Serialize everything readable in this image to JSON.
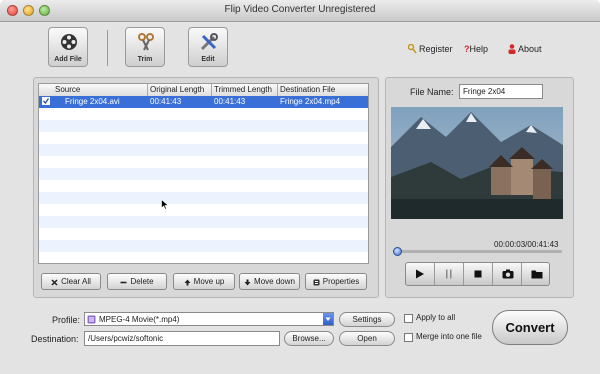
{
  "window": {
    "title": "Flip Video Converter Unregistered"
  },
  "toolbar": {
    "add_file": "Add File",
    "trim": "Trim",
    "edit": "Edit"
  },
  "links": {
    "register": "Register",
    "help": "Help",
    "about": "About"
  },
  "table": {
    "columns": [
      "Source",
      "Original Length",
      "Trimmed Length",
      "Destination File"
    ],
    "rows": [
      {
        "source": "Fringe 2x04.avi",
        "original": "00:41:43",
        "trimmed": "00:41:43",
        "destination": "Fringe 2x04.mp4",
        "checked": true,
        "selected": true
      }
    ]
  },
  "list_buttons": {
    "clear_all": "Clear All",
    "delete": "Delete",
    "move_up": "Move up",
    "move_down": "Move down",
    "properties": "Properties"
  },
  "preview": {
    "file_name_label": "File Name:",
    "file_name_value": "Fringe 2x04",
    "time": "00:00:03/00:41:43",
    "progress": 0.0012
  },
  "output": {
    "profile_label": "Profile:",
    "profile_value": "MPEG-4 Movie(*.mp4)",
    "settings": "Settings",
    "destination_label": "Destination:",
    "destination_value": "/Users/pcwiz/softonic",
    "browse": "Browse...",
    "open": "Open",
    "apply_to_all": "Apply to all",
    "merge": "Merge into one file",
    "convert": "Convert"
  },
  "colors": {
    "selection": "#3a6fd8",
    "window_bg": "#e3e3e3"
  }
}
